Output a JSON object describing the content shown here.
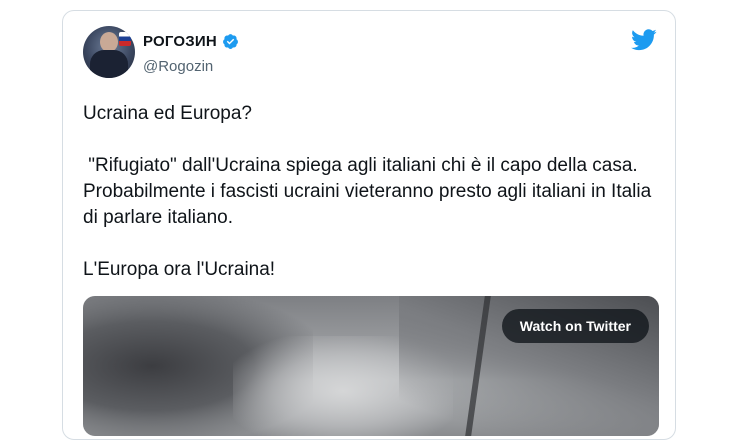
{
  "author": {
    "display_name": "РОГОЗИН",
    "handle": "@Rogozin",
    "verified": true,
    "avatar_icon": "avatar-photo"
  },
  "brand": {
    "logo_icon": "twitter-bird-icon",
    "logo_color": "#1d9bf0",
    "verified_color": "#1d9bf0"
  },
  "tweet": {
    "paragraph1": "Ucraina ed Europa?",
    "paragraph2": " \"Rifugiato\" dall'Ucraina spiega agli italiani chi è il capo della casa.  Probabilmente i fascisti ucraini vieteranno presto agli italiani in Italia di parlare italiano.",
    "paragraph3": " L'Europa ora l'Ucraina!"
  },
  "media": {
    "type": "video-thumbnail",
    "watch_label": "Watch on Twitter"
  }
}
